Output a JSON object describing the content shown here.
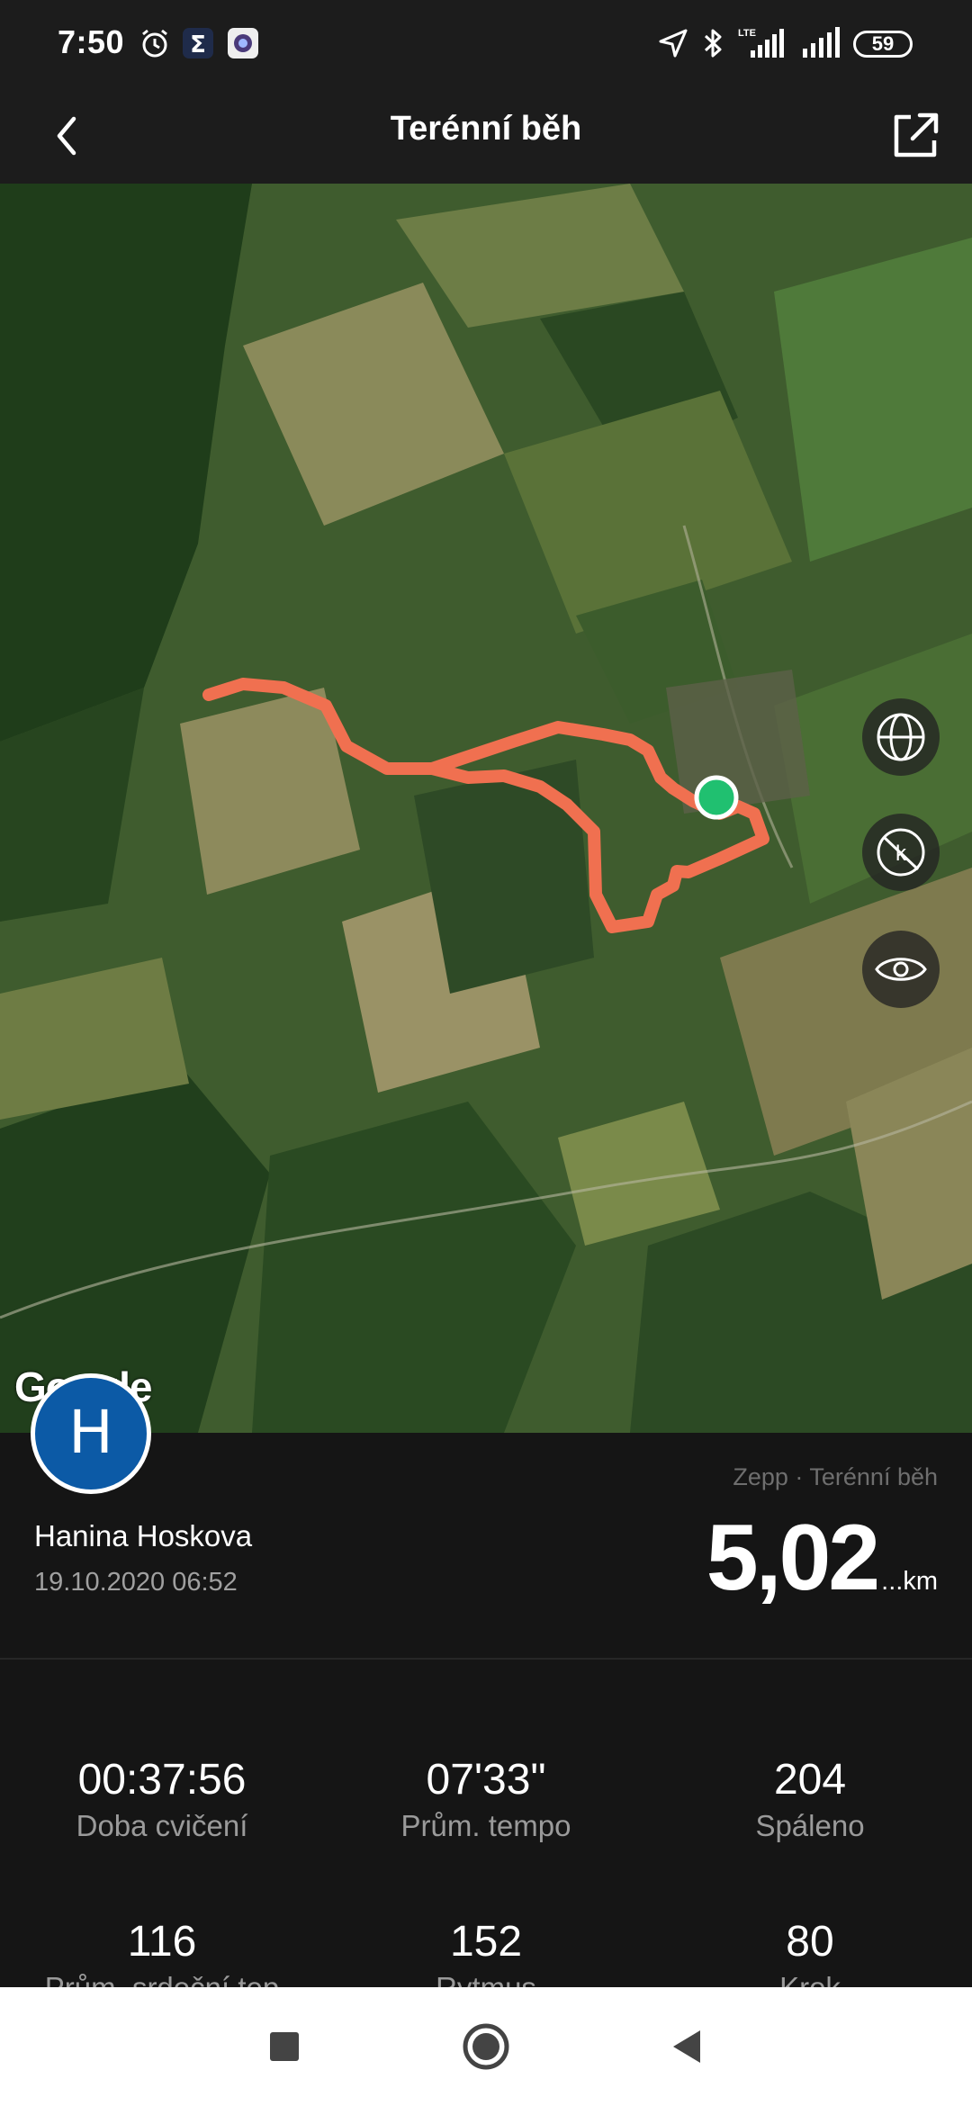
{
  "status_bar": {
    "time": "7:50",
    "battery": "59",
    "network_label": "LTE",
    "icons": [
      "alarm-icon",
      "sigma-app-icon",
      "camera-app-icon",
      "location-icon",
      "bluetooth-icon",
      "lte-signal-icon",
      "signal-icon",
      "battery-icon"
    ]
  },
  "header": {
    "title": "Terénní běh",
    "back_icon": "chevron-left-icon",
    "share_icon": "share-icon"
  },
  "map": {
    "provider_logo": "Google",
    "controls": [
      "globe-icon",
      "km-markers-off-icon",
      "eye-icon"
    ],
    "route_color": "#f07050",
    "start_marker_color": "#20c070"
  },
  "user": {
    "avatar_initial": "H",
    "name": "Hanina Hoskova",
    "date": "19.10.2020 06:52"
  },
  "workout": {
    "source": "Zepp · Terénní běh",
    "distance": "5,02",
    "distance_unit": "...km"
  },
  "stats": [
    {
      "value": "00:37:56",
      "label": "Doba cvičení"
    },
    {
      "value": "07'33\"",
      "label": "Prům. tempo"
    },
    {
      "value": "204",
      "label": "Spáleno"
    },
    {
      "value": "116",
      "label": "Prům. srdeční tep"
    },
    {
      "value": "152",
      "label": "Rytmus"
    },
    {
      "value": "80",
      "label": "Krok"
    }
  ],
  "nav": [
    "recents-button",
    "home-button",
    "back-button"
  ],
  "colors": {
    "accent_blue": "#0c5aa6",
    "background": "#151515"
  }
}
